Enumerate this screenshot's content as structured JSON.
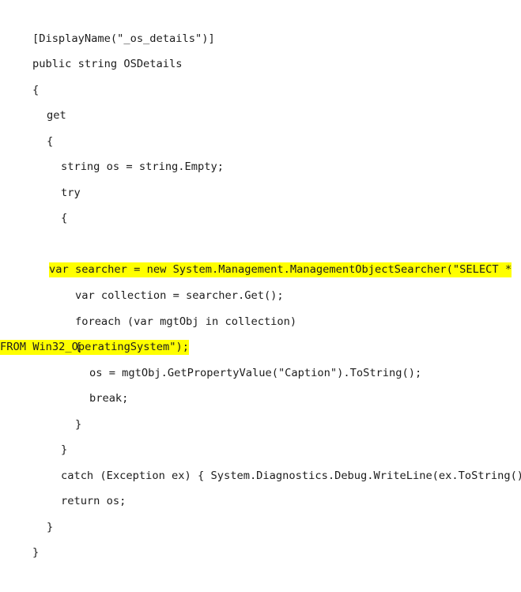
{
  "document": {
    "kind": "code-snippet",
    "language": "csharp",
    "background_color": "#ffffff",
    "text_color": "#1c1c1c",
    "highlight_color": "#ffff00"
  },
  "code": {
    "lines": [
      {
        "id": "line-1",
        "indent": 0,
        "text": "[DisplayName(\"_os_details\")]",
        "highlighted": false
      },
      {
        "id": "line-2",
        "indent": 0,
        "text": "public string OSDetails",
        "highlighted": false
      },
      {
        "id": "line-3",
        "indent": 0,
        "text": "{",
        "highlighted": false
      },
      {
        "id": "line-4",
        "indent": 2,
        "text": "get",
        "highlighted": false
      },
      {
        "id": "line-5",
        "indent": 2,
        "text": "{",
        "highlighted": false
      },
      {
        "id": "line-6",
        "indent": 4,
        "text": "string os = string.Empty;",
        "highlighted": false
      },
      {
        "id": "line-7",
        "indent": 4,
        "text": "try",
        "highlighted": false
      },
      {
        "id": "line-8",
        "indent": 4,
        "text": "{",
        "highlighted": false
      },
      {
        "id": "line-9",
        "indent": 6,
        "text": "var searcher = new System.Management.ManagementObjectSearcher(\"SELECT * FROM Win32_OperatingSystem\");",
        "highlighted": true,
        "wrap_part_1": "var searcher = new System.Management.ManagementObjectSearcher(\"SELECT *",
        "wrap_part_2": "FROM Win32_OperatingSystem\");"
      },
      {
        "id": "line-10",
        "indent": 6,
        "text": "var collection = searcher.Get();",
        "highlighted": false
      },
      {
        "id": "line-11",
        "indent": 6,
        "text": "foreach (var mgtObj in collection)",
        "highlighted": false
      },
      {
        "id": "line-12",
        "indent": 6,
        "text": "{",
        "highlighted": false
      },
      {
        "id": "line-13",
        "indent": 8,
        "text": "os = mgtObj.GetPropertyValue(\"Caption\").ToString();",
        "highlighted": false
      },
      {
        "id": "line-14",
        "indent": 8,
        "text": "break;",
        "highlighted": false
      },
      {
        "id": "line-15",
        "indent": 6,
        "text": "}",
        "highlighted": false
      },
      {
        "id": "line-16",
        "indent": 4,
        "text": "}",
        "highlighted": false
      },
      {
        "id": "line-17",
        "indent": 4,
        "text": "catch (Exception ex) { System.Diagnostics.Debug.WriteLine(ex.ToString()); }",
        "highlighted": false
      },
      {
        "id": "line-18",
        "indent": 4,
        "text": "return os;",
        "highlighted": false
      },
      {
        "id": "line-19",
        "indent": 2,
        "text": "}",
        "highlighted": false
      },
      {
        "id": "line-20",
        "indent": 0,
        "text": "}",
        "highlighted": false
      }
    ]
  }
}
